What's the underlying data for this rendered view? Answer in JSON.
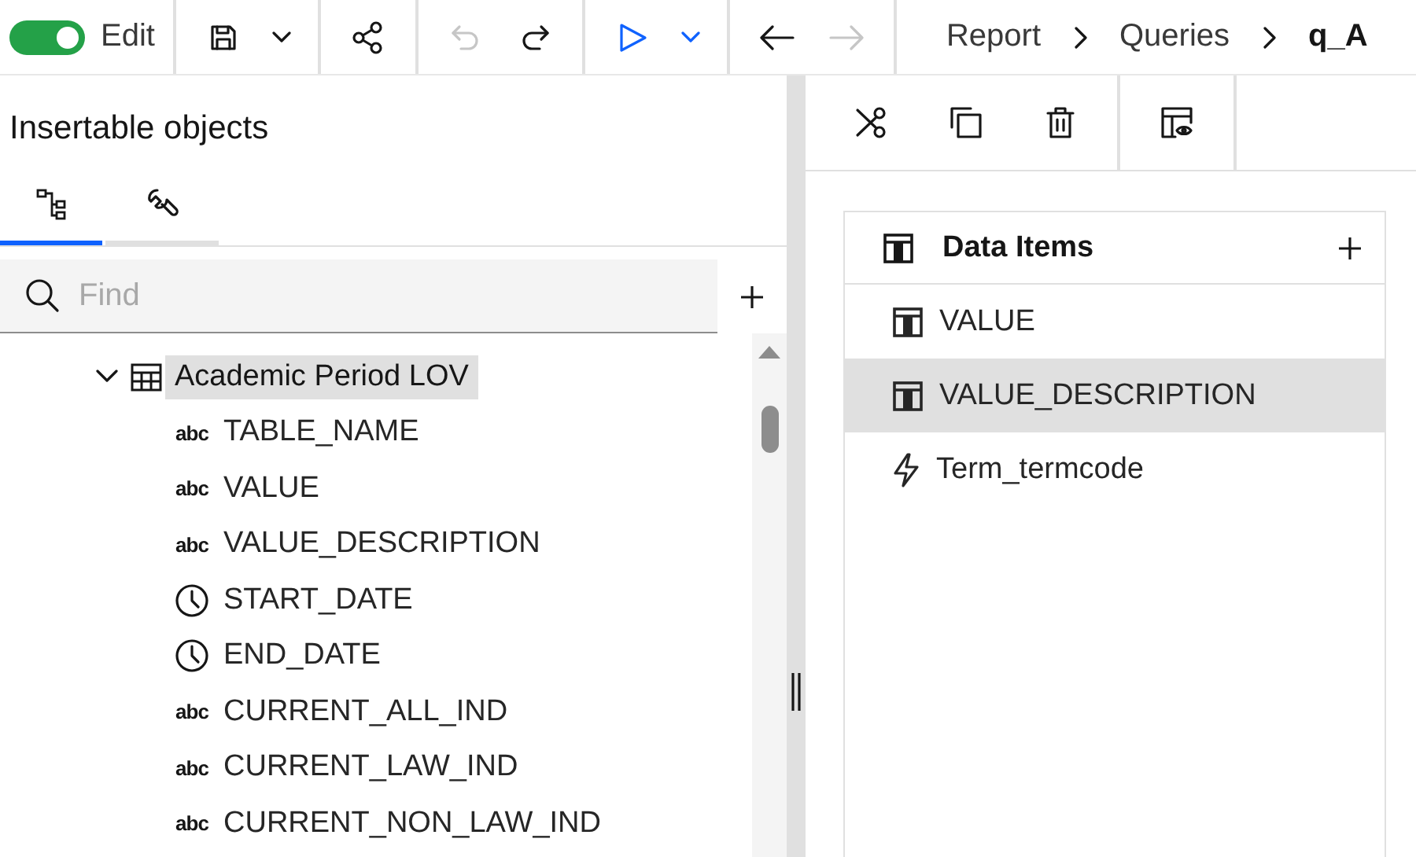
{
  "toolbar": {
    "edit_toggle": {
      "label": "Edit",
      "on": true
    },
    "groups": [
      [
        {
          "kind": "save",
          "disabled": false
        },
        {
          "kind": "caret",
          "disabled": false
        }
      ],
      [
        {
          "kind": "share",
          "disabled": false
        }
      ],
      [
        {
          "kind": "undo",
          "disabled": true
        },
        {
          "kind": "redo",
          "disabled": false
        }
      ],
      [
        {
          "kind": "run",
          "disabled": false
        },
        {
          "kind": "run-caret",
          "disabled": false
        }
      ],
      [
        {
          "kind": "back",
          "disabled": false
        },
        {
          "kind": "forward",
          "disabled": true
        }
      ]
    ],
    "breadcrumbs": [
      {
        "label": "Report",
        "current": false
      },
      {
        "label": "Queries",
        "current": false
      },
      {
        "label": "q_A",
        "current": true
      }
    ]
  },
  "insertable_objects": {
    "title": "Insertable objects",
    "tabs": [
      {
        "kind": "tree",
        "selected": true
      },
      {
        "kind": "tools",
        "selected": false
      }
    ],
    "search": {
      "placeholder": "Find"
    },
    "tree": [
      {
        "label": "Academic Period LOV",
        "kind": "table",
        "expanded": true,
        "selected": true,
        "children": [
          {
            "label": "TABLE_NAME",
            "kind": "text",
            "type_glyph": "abc"
          },
          {
            "label": "VALUE",
            "kind": "text",
            "type_glyph": "abc"
          },
          {
            "label": "VALUE_DESCRIPTION",
            "kind": "text",
            "type_glyph": "abc"
          },
          {
            "label": "START_DATE",
            "kind": "date"
          },
          {
            "label": "END_DATE",
            "kind": "date"
          },
          {
            "label": "CURRENT_ALL_IND",
            "kind": "text",
            "type_glyph": "abc"
          },
          {
            "label": "CURRENT_LAW_IND",
            "kind": "text",
            "type_glyph": "abc"
          },
          {
            "label": "CURRENT_NON_LAW_IND",
            "kind": "text",
            "type_glyph": "abc"
          }
        ]
      }
    ]
  },
  "query_panel": {
    "tools": [
      [
        {
          "kind": "cut"
        },
        {
          "kind": "copy"
        },
        {
          "kind": "delete"
        }
      ],
      [
        {
          "kind": "table-preview"
        }
      ]
    ],
    "data_items": {
      "title": "Data Items",
      "items": [
        {
          "label": "VALUE",
          "kind": "column",
          "selected": false
        },
        {
          "label": "VALUE_DESCRIPTION",
          "kind": "column",
          "selected": true
        },
        {
          "label": "Term_termcode",
          "kind": "calculation",
          "selected": false
        }
      ]
    }
  }
}
